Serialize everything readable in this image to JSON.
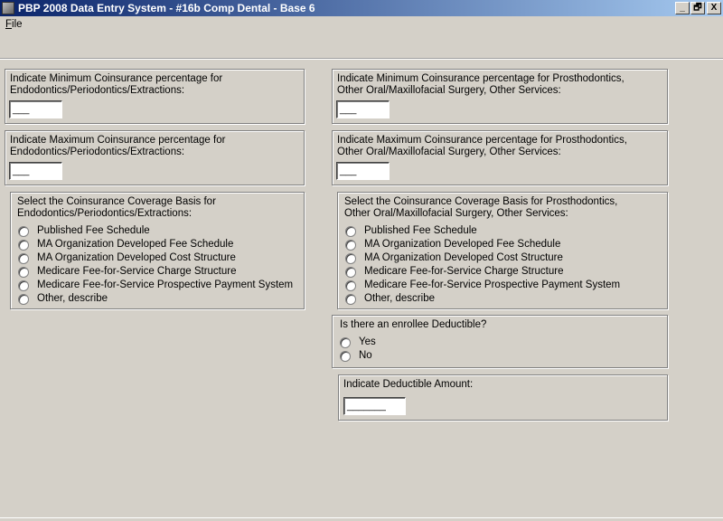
{
  "window": {
    "title": "PBP 2008 Data Entry System - #16b Comp Dental - Base 6",
    "minimize": "_",
    "restore": "🗗",
    "close": "X"
  },
  "menu": {
    "file_prefix": "F",
    "file_rest": "ile"
  },
  "left": {
    "min_label": "Indicate Minimum Coinsurance percentage for Endodontics/Periodontics/Extractions:",
    "min_value": "___",
    "max_label": "Indicate Maximum Coinsurance percentage for Endodontics/Periodontics/Extractions:",
    "max_value": "___",
    "basis_label": "Select the Coinsurance Coverage Basis for Endodontics/Periodontics/Extractions:",
    "basis_options": [
      "Published Fee Schedule",
      "MA Organization Developed Fee Schedule",
      "MA Organization Developed Cost Structure",
      "Medicare Fee-for-Service Charge Structure",
      "Medicare Fee-for-Service Prospective Payment System",
      "Other, describe"
    ]
  },
  "right": {
    "min_label": "Indicate Minimum Coinsurance percentage for Prosthodontics, Other Oral/Maxillofacial Surgery, Other Services:",
    "min_value": "___",
    "max_label": "Indicate Maximum Coinsurance percentage for Prosthodontics, Other Oral/Maxillofacial Surgery, Other Services:",
    "max_value": "___",
    "basis_label": "Select the Coinsurance Coverage Basis for Prosthodontics, Other Oral/Maxillofacial Surgery, Other Services:",
    "basis_options": [
      "Published Fee Schedule",
      "MA Organization Developed Fee Schedule",
      "MA Organization Developed Cost Structure",
      "Medicare Fee-for-Service Charge Structure",
      "Medicare Fee-for-Service Prospective Payment System",
      "Other, describe"
    ],
    "deductible_question": "Is there an enrollee Deductible?",
    "deductible_options": [
      "Yes",
      "No"
    ],
    "deductible_amount_label": "Indicate Deductible Amount:",
    "deductible_amount_value": "_______"
  }
}
